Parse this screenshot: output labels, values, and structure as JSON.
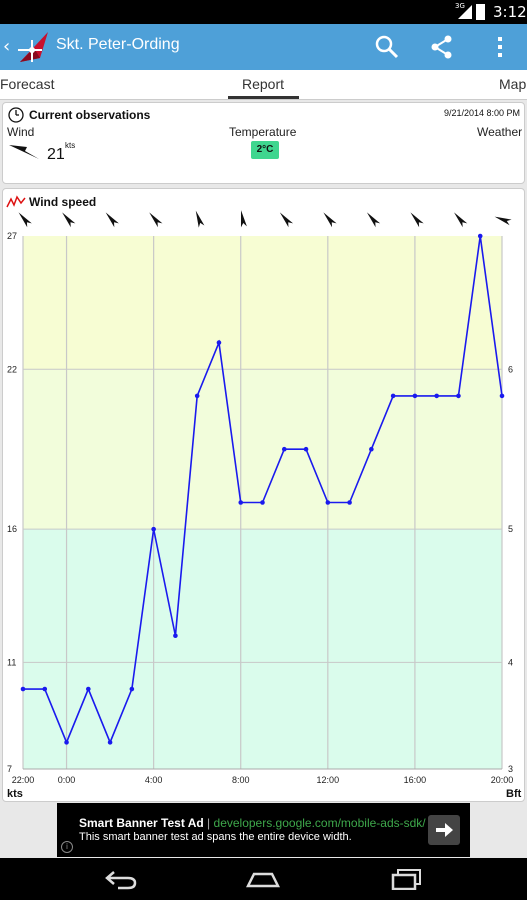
{
  "status_bar": {
    "time": "3:12",
    "network": "3G"
  },
  "action_bar": {
    "title": "Skt. Peter-Ording",
    "icons": [
      "back-icon",
      "app-logo",
      "search-icon",
      "share-icon",
      "overflow-menu-icon"
    ]
  },
  "tabs": [
    {
      "label": "Forecast",
      "selected": false
    },
    {
      "label": "Report",
      "selected": true
    },
    {
      "label": "Map",
      "selected": false
    }
  ],
  "observations": {
    "heading": "Current observations",
    "timestamp": "9/21/2014 8:00 PM",
    "wind_label": "Wind",
    "temperature_label": "Temperature",
    "weather_label": "Weather",
    "wind_value": "21",
    "wind_unit": "kts",
    "temperature_value": "2°C",
    "temperature_color": "#3fd68f"
  },
  "wind_card": {
    "heading": "Wind speed"
  },
  "chart_data": {
    "type": "line",
    "title": "Wind speed",
    "xlabel": "",
    "ylabel_left": "kts",
    "ylabel_right": "Bft",
    "x_tick_labels": [
      "22:00",
      "0:00",
      "4:00",
      "8:00",
      "12:00",
      "16:00",
      "20:00"
    ],
    "x_tick_hours": [
      -2,
      0,
      4,
      8,
      12,
      16,
      20
    ],
    "y_ticks_left": [
      "27",
      "22",
      "16",
      "11",
      "7"
    ],
    "y_ticks_left_values": [
      27,
      22,
      16,
      11,
      7
    ],
    "y_ticks_right": [
      "6",
      "5",
      "4",
      "3"
    ],
    "y_ticks_right_kts": [
      22,
      16,
      11,
      7
    ],
    "ylim": [
      7,
      27
    ],
    "xlim": [
      -2,
      20
    ],
    "bands": [
      {
        "from": 7,
        "to": 16,
        "color": "#dafcec"
      },
      {
        "from": 16,
        "to": 22,
        "color": "#f2fddb"
      },
      {
        "from": 22,
        "to": 27,
        "color": "#f7fdd3"
      }
    ],
    "series": [
      {
        "color": "#1a1aee",
        "x": [
          -2,
          -1,
          0,
          1,
          2,
          3,
          4,
          5,
          6,
          7,
          8,
          9,
          10,
          11,
          12,
          13,
          14,
          15,
          16,
          17,
          18,
          19,
          20
        ],
        "values": [
          10,
          10,
          8,
          10,
          8,
          10,
          16,
          12,
          21,
          23,
          17,
          17,
          19,
          19,
          17,
          17,
          19,
          21,
          21,
          21,
          21,
          27,
          21
        ]
      }
    ],
    "direction_arrows_deg": [
      320,
      320,
      320,
      320,
      340,
      350,
      320,
      320,
      320,
      320,
      320,
      290
    ],
    "grid": true,
    "legend": "none"
  },
  "ad": {
    "title": "Smart Banner Test Ad",
    "separator": "|",
    "url": "developers.google.com/mobile-ads-sdk/",
    "text": "This smart banner test ad spans the entire device width.",
    "info_glyph": "i"
  }
}
